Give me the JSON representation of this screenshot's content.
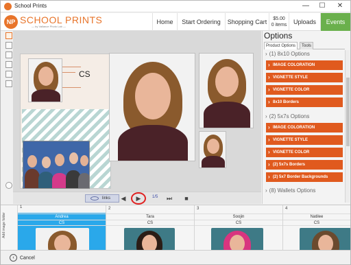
{
  "window": {
    "title": "School Prints",
    "minimize": "—",
    "maximize": "☐",
    "close": "✕"
  },
  "brand": {
    "mark": "NP",
    "name": "SCHOOL PRINTS",
    "tagline": "— by Vallance Photo Lab —"
  },
  "nav": {
    "home": "Home",
    "start_ordering": "Start Ordering",
    "shopping_cart": "Shopping Cart",
    "cart_amount": "$5.00",
    "cart_items": "0 items",
    "uploads": "Uploads",
    "events": "Events"
  },
  "canvas": {
    "sheet_label": "CS"
  },
  "playback": {
    "links_label": "links",
    "counter": "1/5",
    "prev": "◀",
    "play": "▶",
    "next": "⏭",
    "stop": "■"
  },
  "options": {
    "title": "Options",
    "tabs": [
      "Product Options",
      "Tools"
    ],
    "sections": [
      {
        "label": "(1) 8x10 Options",
        "items": [
          "IMAGE COLORATION",
          "VIGNETTE STYLE",
          "VIGNETTE COLOR",
          "8x10 Borders"
        ]
      },
      {
        "label": "(2) 5x7s Options",
        "items": [
          "IMAGE COLORATION",
          "VIGNETTE STYLE",
          "VIGNETTE COLOR",
          "(2) 5x7s Borders",
          "(2) 5x7 Border Backgrounds"
        ]
      },
      {
        "label": "(8) Wallets Options",
        "items": []
      }
    ]
  },
  "sidebar_vertical": "Add image folder",
  "students": [
    {
      "num": "1",
      "name": "Andrea",
      "code": "CS"
    },
    {
      "num": "2",
      "name": "Tara",
      "code": "CS"
    },
    {
      "num": "3",
      "name": "Soojin",
      "code": "CS"
    },
    {
      "num": "4",
      "name": "Natilee",
      "code": "CS"
    }
  ],
  "status": {
    "cancel": "Cancel"
  },
  "colors": {
    "accent": "#e05a1e",
    "brand": "#e8742a",
    "events": "#6ab04c",
    "selected": "#2aa8ea"
  }
}
